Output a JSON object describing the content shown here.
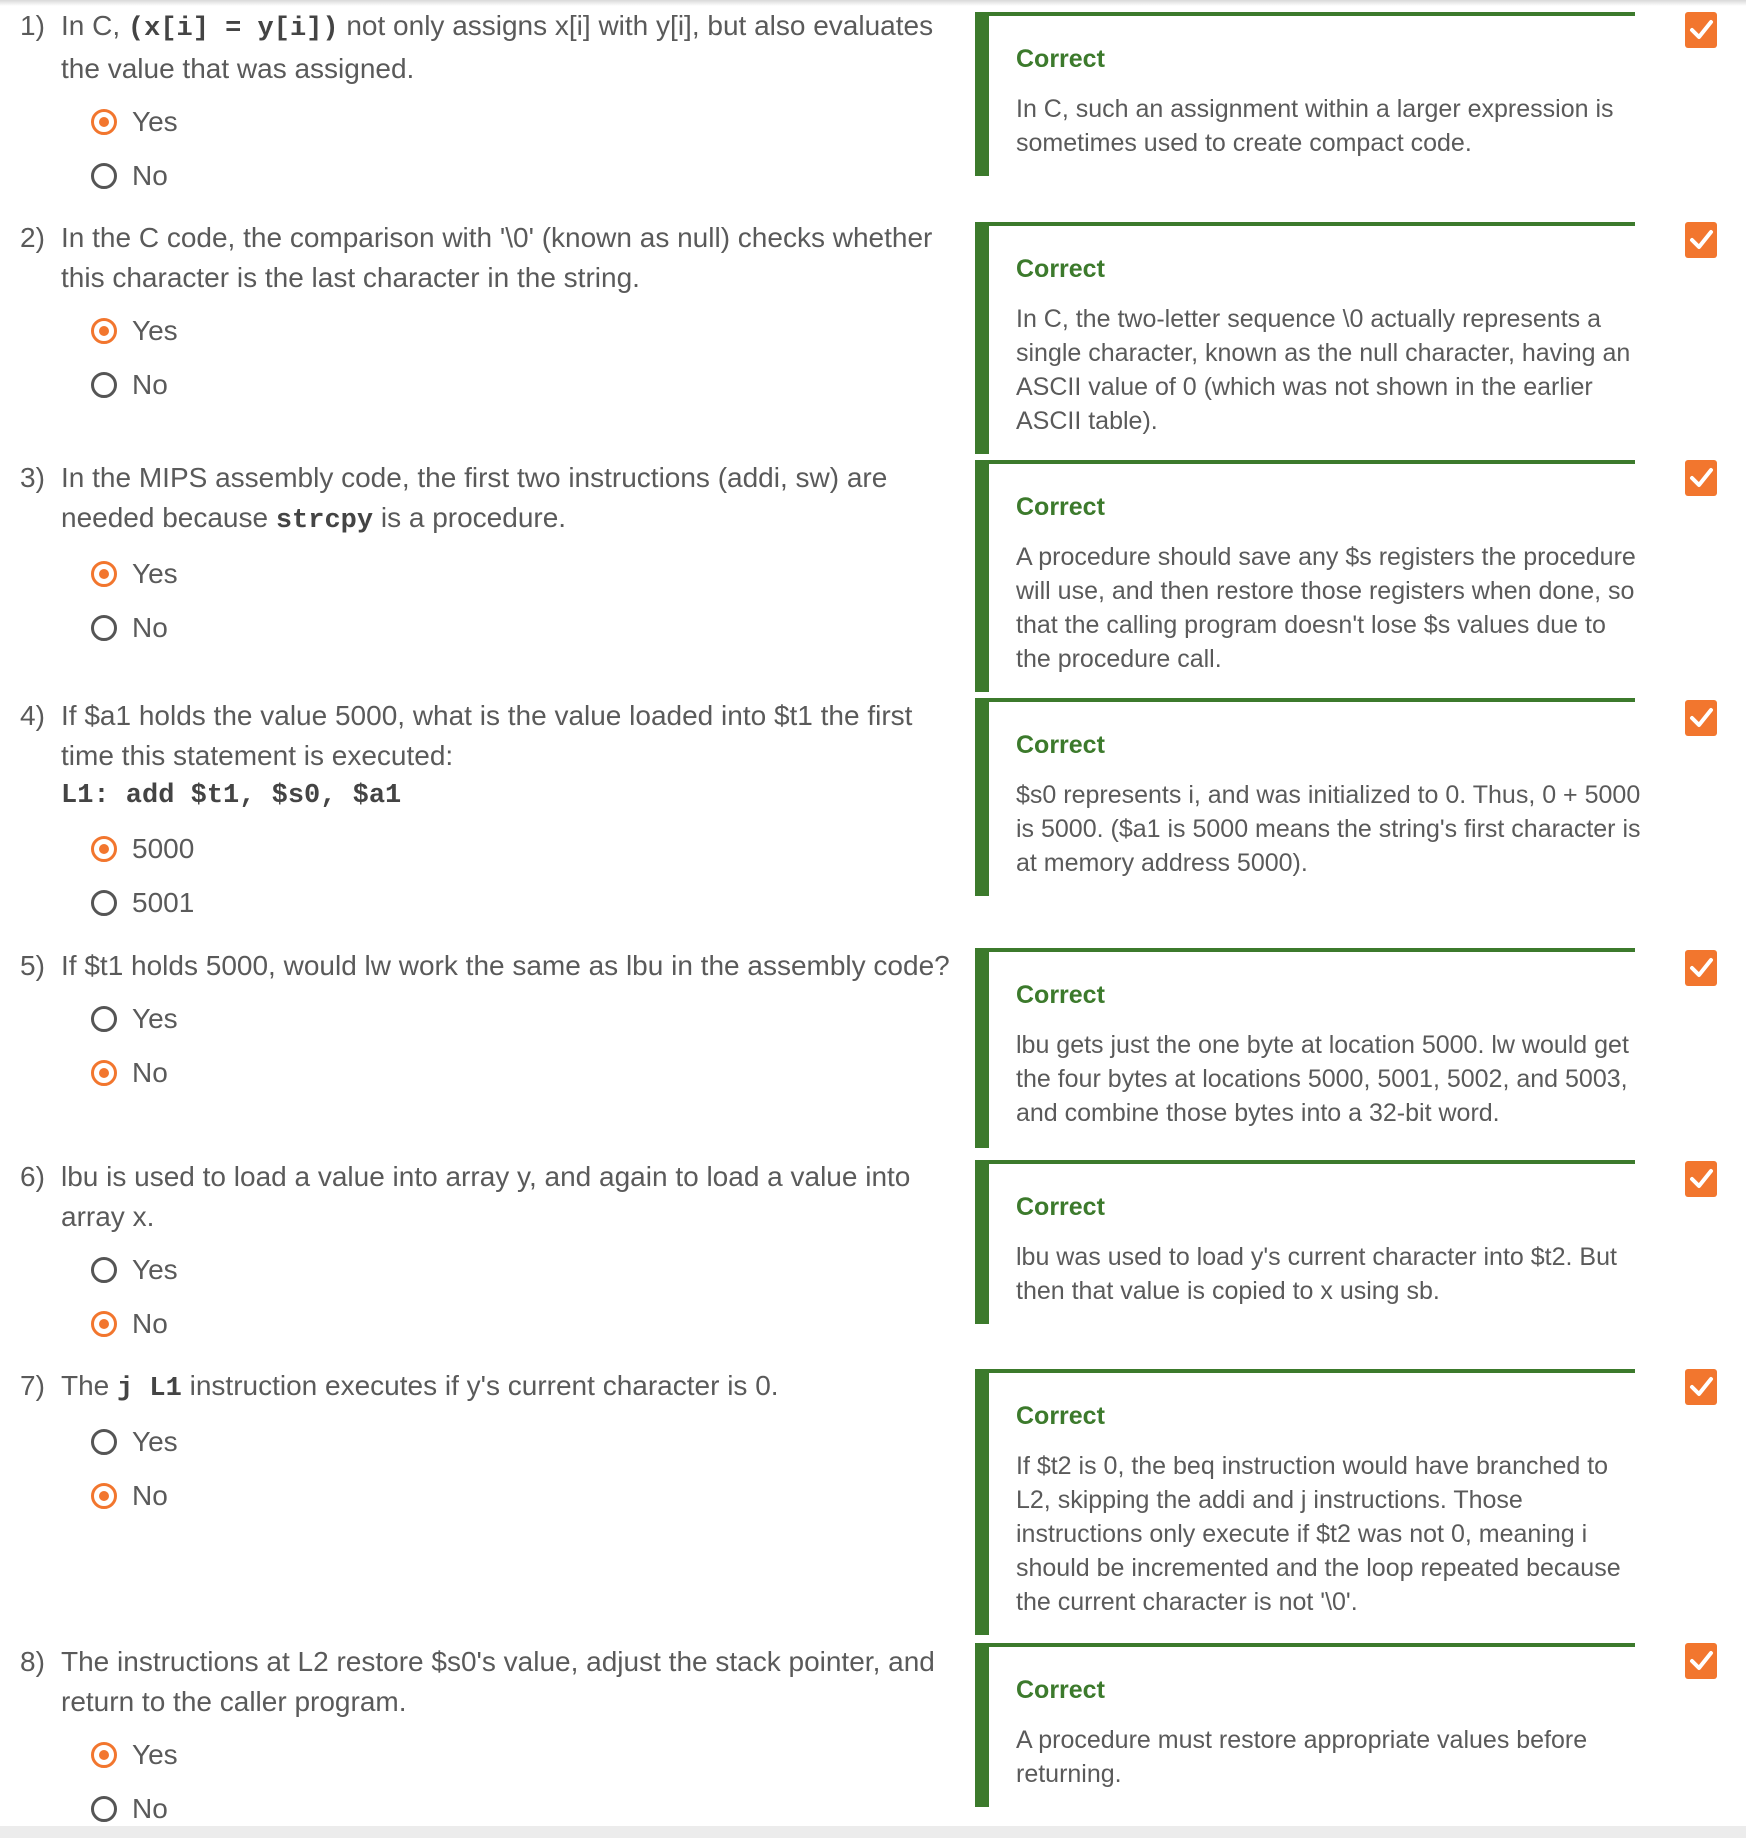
{
  "questions": [
    {
      "number": "1)",
      "text_before": "In C, ",
      "code": "(x[i] = y[i])",
      "text_after": " not only assigns x[i] with y[i], but also evaluates the value that was assigned.",
      "choices": [
        {
          "label": "Yes",
          "selected": true
        },
        {
          "label": "No",
          "selected": false
        }
      ],
      "feedback_title": "Correct",
      "feedback_text": "In C, such an assignment within a larger expression is sometimes used to create compact code."
    },
    {
      "number": "2)",
      "text": "In the C code, the comparison with '\\0' (known as null) checks whether this character is the last character in the string.",
      "choices": [
        {
          "label": "Yes",
          "selected": true
        },
        {
          "label": "No",
          "selected": false
        }
      ],
      "feedback_title": "Correct",
      "feedback_text": "In C, the two-letter sequence \\0 actually represents a single character, known as the null character, having an ASCII value of 0 (which was not shown in the earlier ASCII table)."
    },
    {
      "number": "3)",
      "text_before": "In the MIPS assembly code, the first two instructions (addi, sw) are needed because ",
      "code": "strcpy",
      "text_after": " is a procedure.",
      "choices": [
        {
          "label": "Yes",
          "selected": true
        },
        {
          "label": "No",
          "selected": false
        }
      ],
      "feedback_title": "Correct",
      "feedback_text": "A procedure should save any $s registers the procedure will use, and then restore those registers when done, so that the calling program doesn't lose $s values due to the procedure call."
    },
    {
      "number": "4)",
      "text": "If $a1 holds the value 5000, what is the value loaded into $t1 the first time this statement is executed:",
      "code_line": "L1: add $t1, $s0, $a1",
      "choices": [
        {
          "label": "5000",
          "selected": true
        },
        {
          "label": "5001",
          "selected": false
        }
      ],
      "feedback_title": "Correct",
      "feedback_text": "$s0 represents i, and was initialized to 0. Thus, 0 + 5000 is 5000. ($a1 is 5000 means the string's first character is at memory address 5000)."
    },
    {
      "number": "5)",
      "text": "If $t1 holds 5000, would lw work the same as lbu in the assembly code?",
      "choices": [
        {
          "label": "Yes",
          "selected": false
        },
        {
          "label": "No",
          "selected": true
        }
      ],
      "feedback_title": "Correct",
      "feedback_text": "lbu gets just the one byte at location 5000. lw would get the four bytes at locations 5000, 5001, 5002, and 5003, and combine those bytes into a 32-bit word."
    },
    {
      "number": "6)",
      "text": "lbu is used to load a value into array y, and again to load a value into array x.",
      "choices": [
        {
          "label": "Yes",
          "selected": false
        },
        {
          "label": "No",
          "selected": true
        }
      ],
      "feedback_title": "Correct",
      "feedback_text": "lbu was used to load y's current character into $t2. But then that value is copied to x using sb."
    },
    {
      "number": "7)",
      "text_before": "The ",
      "code": "j L1",
      "text_after": " instruction executes if y's current character is 0.",
      "choices": [
        {
          "label": "Yes",
          "selected": false
        },
        {
          "label": "No",
          "selected": true
        }
      ],
      "feedback_title": "Correct",
      "feedback_text": "If $t2 is 0, the beq instruction would have branched to L2, skipping the addi and j instructions. Those instructions only execute if $t2 was not 0, meaning i should be incremented and the loop repeated because the current character is not '\\0'."
    },
    {
      "number": "8)",
      "text": "The instructions at L2 restore $s0's value, adjust the stack pointer, and return to the caller program.",
      "choices": [
        {
          "label": "Yes",
          "selected": true
        },
        {
          "label": "No",
          "selected": false
        }
      ],
      "feedback_title": "Correct",
      "feedback_text": "A procedure must restore appropriate values before returning."
    }
  ],
  "colors": {
    "accent_orange": "#f2762e",
    "correct_green": "#3c7a2c",
    "text_gray": "#5a5a5a"
  },
  "icons": {
    "selected_radio": "radio-selected-icon",
    "unselected_radio": "radio-unselected-icon",
    "status": "checkmark-icon"
  }
}
